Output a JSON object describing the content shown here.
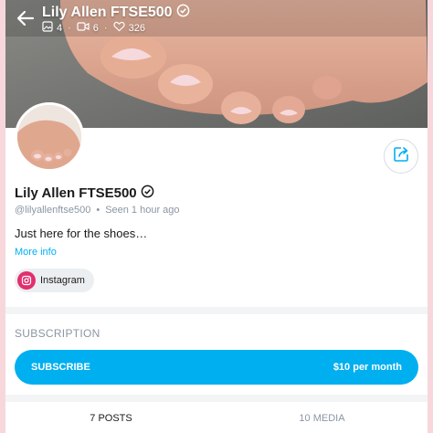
{
  "header": {
    "title": "Lily Allen FTSE500",
    "stats": {
      "photos": "4",
      "videos": "6",
      "likes": "326"
    }
  },
  "profile": {
    "name": "Lily Allen FTSE500",
    "handle": "@lilyallenftse500",
    "last_seen": "Seen  1 hour ago",
    "bio": "Just here for the shoes…",
    "more_info": "More info",
    "social_link": "Instagram"
  },
  "subscription": {
    "label": "SUBSCRIPTION",
    "button_label": "SUBSCRIBE",
    "price": "$10 per month"
  },
  "tabs": [
    {
      "label": "7 POSTS",
      "active": true
    },
    {
      "label": "10 MEDIA",
      "active": false
    }
  ],
  "colors": {
    "accent": "#00aff0",
    "instagram": "#e1306c",
    "muted": "#8a96a3"
  },
  "icons": [
    "back-arrow-icon",
    "verified-icon",
    "image-icon",
    "video-icon",
    "heart-icon",
    "share-icon",
    "instagram-icon"
  ]
}
